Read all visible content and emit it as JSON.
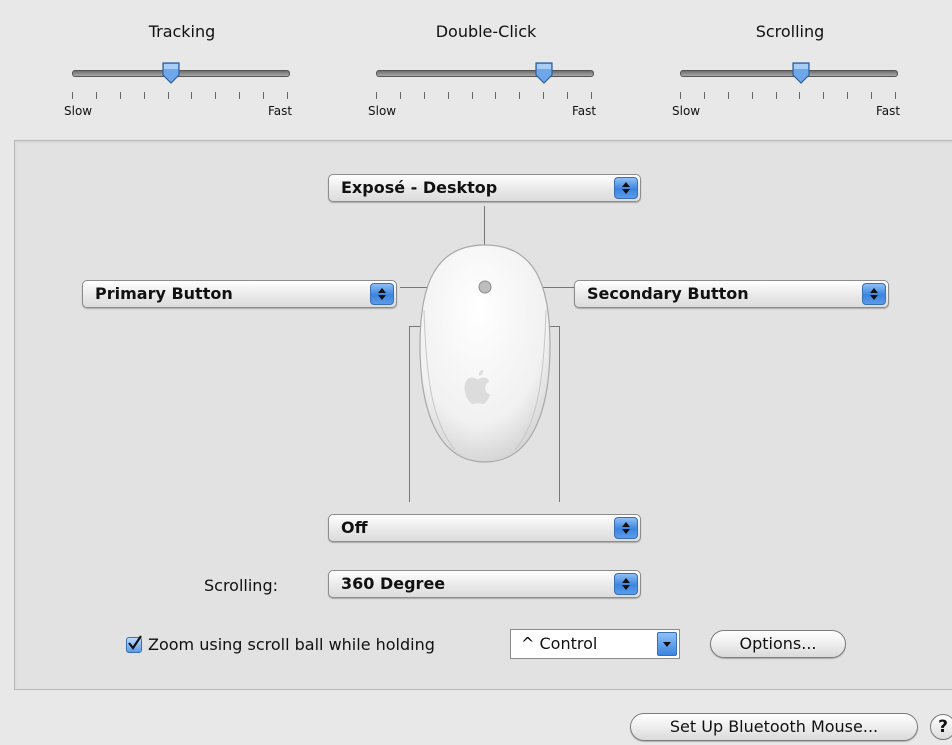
{
  "sliders": [
    {
      "title": "Tracking",
      "min_label": "Slow",
      "max_label": "Fast",
      "value_fraction": 0.45
    },
    {
      "title": "Double-Click",
      "min_label": "Slow",
      "max_label": "Fast",
      "value_fraction": 0.77
    },
    {
      "title": "Scrolling",
      "min_label": "Slow",
      "max_label": "Fast",
      "value_fraction": 0.56
    }
  ],
  "mouse": {
    "top_popup": "Exposé - Desktop",
    "left_popup": "Primary Button",
    "right_popup": "Secondary Button",
    "squeeze_popup": "Off"
  },
  "scrolling": {
    "label": "Scrolling:",
    "value": "360 Degree"
  },
  "zoom": {
    "checked": true,
    "label": "Zoom using scroll ball while holding",
    "modifier": "^ Control",
    "options_label": "Options..."
  },
  "footer": {
    "bluetooth_label": "Set Up Bluetooth Mouse...",
    "help_label": "?"
  },
  "colors": {
    "accent": "#3b85e0"
  }
}
